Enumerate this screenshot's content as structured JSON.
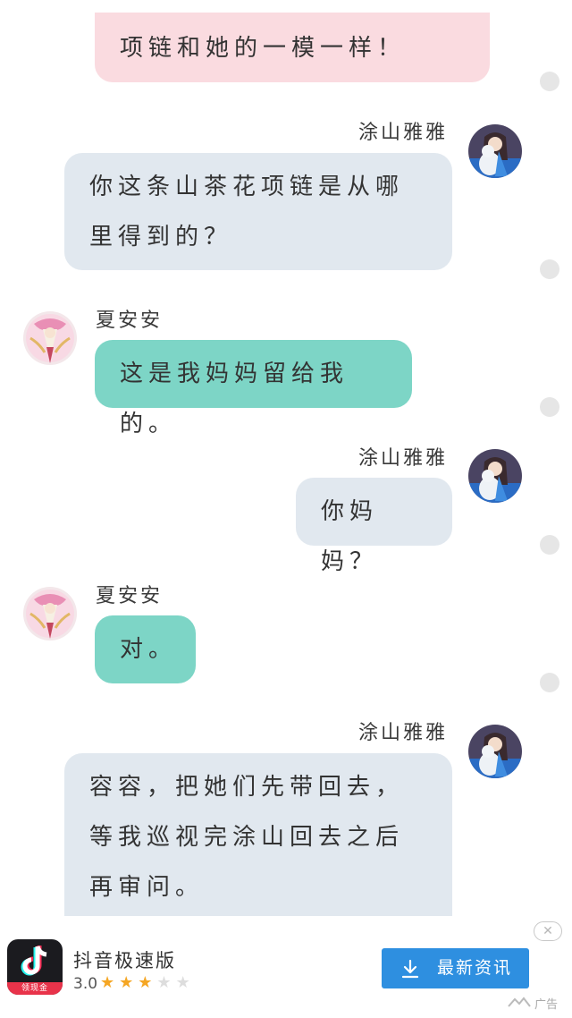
{
  "messages": [
    {
      "sender": "",
      "side": "right",
      "text": "项链和她的一模一样！"
    },
    {
      "sender": "涂山雅雅",
      "side": "right",
      "text": "你这条山茶花项链是从哪里得到的？"
    },
    {
      "sender": "夏安安",
      "side": "left",
      "text": "这是我妈妈留给我的。"
    },
    {
      "sender": "涂山雅雅",
      "side": "right",
      "text": "你妈妈？"
    },
    {
      "sender": "夏安安",
      "side": "left",
      "text": "对。"
    },
    {
      "sender": "涂山雅雅",
      "side": "right",
      "text": "容容，把她们先带回去，等我巡视完涂山回去之后再审问。"
    }
  ],
  "colors": {
    "pink_bubble": "#fadbe0",
    "grey_bubble": "#e1e8ef",
    "teal_bubble": "#7dd5c6",
    "ad_button": "#2e8fe0"
  },
  "ad": {
    "app_name": "抖音极速版",
    "rating": "3.0",
    "stars_filled": 3,
    "stars_total": 5,
    "icon_badge": "领现金",
    "button_label": "最新资讯",
    "ad_label": "广告",
    "close_icon": "close-icon",
    "download_icon": "download-icon"
  }
}
